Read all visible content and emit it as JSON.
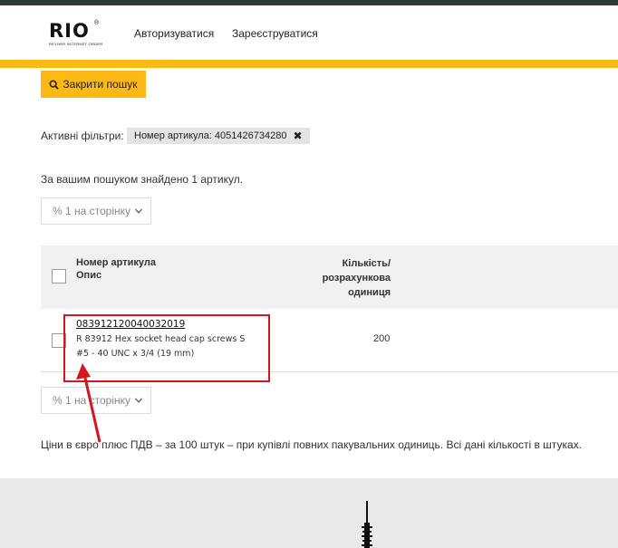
{
  "header": {
    "logo_text": "RIO",
    "logo_reg": "®",
    "logo_tagline": "REYHER INTERNET ORDER",
    "nav": [
      {
        "label": "Авторизуватися"
      },
      {
        "label": "Зареєструватися"
      }
    ]
  },
  "search": {
    "close_label": "Закрити пошук"
  },
  "filters": {
    "label": "Активні фільтри:",
    "chips": [
      {
        "label": "Номер артикула: 4051426734280",
        "remove": "✖"
      }
    ]
  },
  "results": {
    "count_text": "За вашим пошуком знайдено 1 артикул.",
    "per_page": "% 1 на сторінку"
  },
  "table": {
    "col_article_1": "Номер артикула",
    "col_article_2": "Опис",
    "col_qty_1": "Кількість/",
    "col_qty_2": "розрахункова",
    "col_qty_3": "одиниця",
    "rows": [
      {
        "article_no": "083912120040032019",
        "desc_1": "R 83912 Hex socket head cap screws S",
        "desc_2": "#5 - 40 UNC x 3/4 (19 mm)",
        "qty": "200"
      }
    ]
  },
  "price_note": "Ціни в євро плюс ПДВ – за 100 штук – при купівлі повних пакувальних одиниць. Всі дані кількості в штуках.",
  "colors": {
    "brand_yellow": "#fcb813",
    "topbar": "#2f3a34",
    "highlight_red": "#d6161c"
  },
  "icons": {
    "search": "search-icon",
    "remove": "close-icon",
    "dropdown": "chevron-down-icon"
  }
}
